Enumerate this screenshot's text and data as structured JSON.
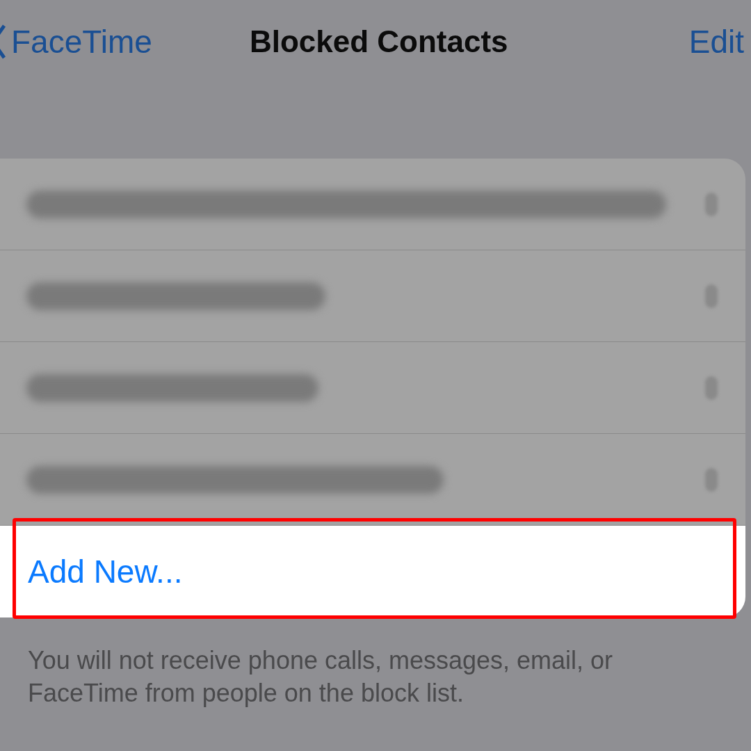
{
  "nav": {
    "back": "FaceTime",
    "title": "Blocked Contacts",
    "action": "Edit"
  },
  "list": {
    "rows": [
      {
        "kind": "redacted"
      },
      {
        "kind": "redacted"
      },
      {
        "kind": "redacted"
      },
      {
        "kind": "redacted"
      }
    ],
    "add": {
      "label": "Add New...",
      "highlighted": true
    }
  },
  "footer": "You will not receive phone calls, messages, email, or FaceTime from people on the block list."
}
